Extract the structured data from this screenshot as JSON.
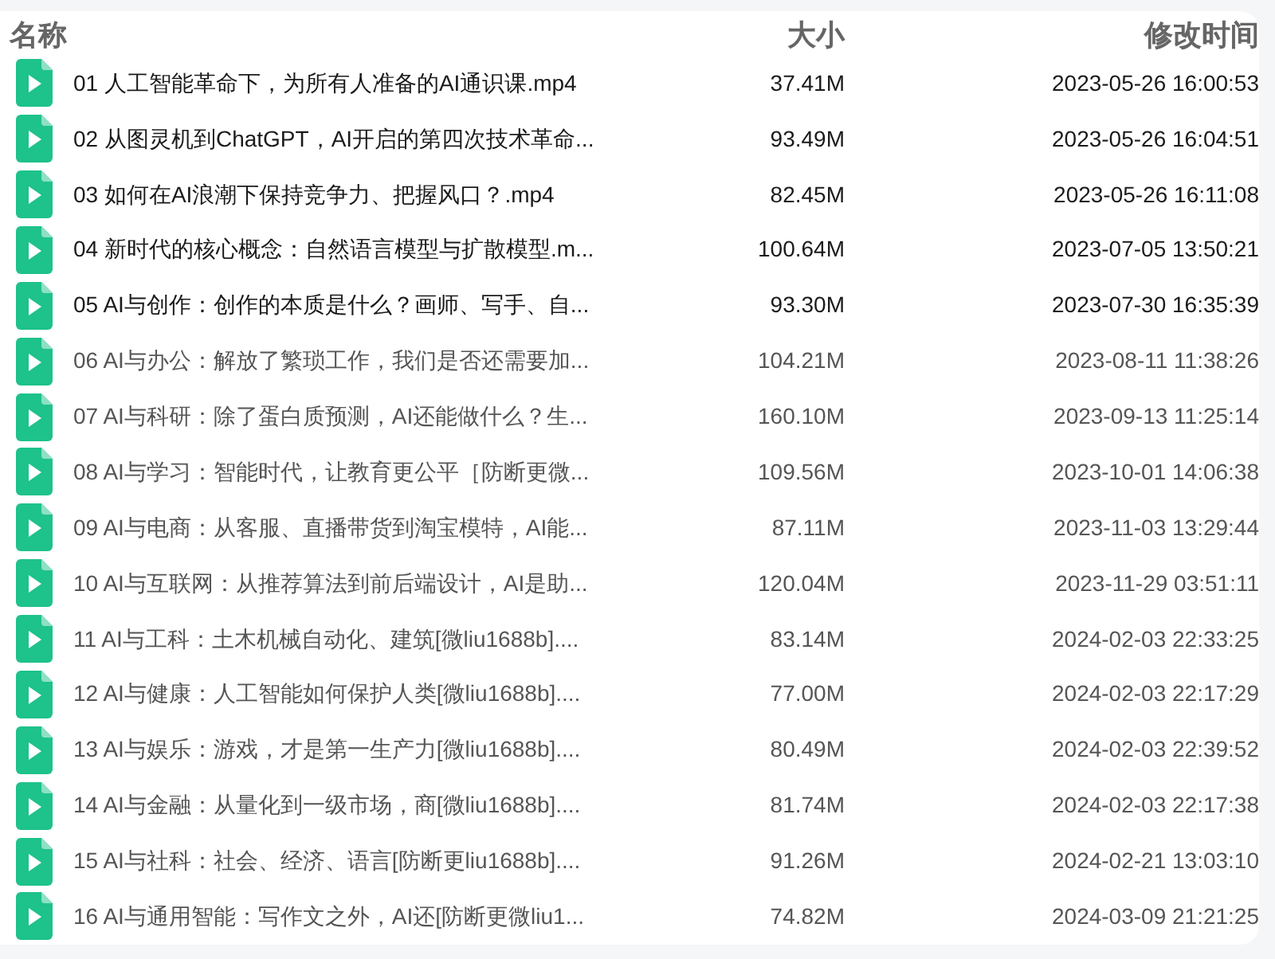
{
  "columns": [
    "名称",
    "大小",
    "修改时间"
  ],
  "files": [
    {
      "name": "01 人工智能革命下，为所有人准备的AI通识课.mp4",
      "size": "37.41M",
      "modified": "2023-05-26 16:00:53",
      "dimmed": false
    },
    {
      "name": "02 从图灵机到ChatGPT，AI开启的第四次技术革命...",
      "size": "93.49M",
      "modified": "2023-05-26 16:04:51",
      "dimmed": false
    },
    {
      "name": "03 如何在AI浪潮下保持竞争力、把握风口？.mp4",
      "size": "82.45M",
      "modified": "2023-05-26 16:11:08",
      "dimmed": false
    },
    {
      "name": "04 新时代的核心概念：自然语言模型与扩散模型.m...",
      "size": "100.64M",
      "modified": "2023-07-05 13:50:21",
      "dimmed": false
    },
    {
      "name": "05 AI与创作：创作的本质是什么？画师、写手、自...",
      "size": "93.30M",
      "modified": "2023-07-30 16:35:39",
      "dimmed": false
    },
    {
      "name": "06 AI与办公：解放了繁琐工作，我们是否还需要加...",
      "size": "104.21M",
      "modified": "2023-08-11 11:38:26",
      "dimmed": true
    },
    {
      "name": "07 AI与科研：除了蛋白质预测，AI还能做什么？生...",
      "size": "160.10M",
      "modified": "2023-09-13 11:25:14",
      "dimmed": true
    },
    {
      "name": "08 AI与学习：智能时代，让教育更公平［防断更微...",
      "size": "109.56M",
      "modified": "2023-10-01 14:06:38",
      "dimmed": true
    },
    {
      "name": "09 AI与电商：从客服、直播带货到淘宝模特，AI能...",
      "size": "87.11M",
      "modified": "2023-11-03 13:29:44",
      "dimmed": true
    },
    {
      "name": "10 AI与互联网：从推荐算法到前后端设计，AI是助...",
      "size": "120.04M",
      "modified": "2023-11-29 03:51:11",
      "dimmed": true
    },
    {
      "name": "11 AI与工科：土木机械自动化、建筑[微liu1688b]....",
      "size": "83.14M",
      "modified": "2024-02-03 22:33:25",
      "dimmed": true
    },
    {
      "name": "12 AI与健康：人工智能如何保护人类[微liu1688b]....",
      "size": "77.00M",
      "modified": "2024-02-03 22:17:29",
      "dimmed": true
    },
    {
      "name": "13 AI与娱乐：游戏，才是第一生产力[微liu1688b]....",
      "size": "80.49M",
      "modified": "2024-02-03 22:39:52",
      "dimmed": true
    },
    {
      "name": "14 AI与金融：从量化到一级市场，商[微liu1688b]....",
      "size": "81.74M",
      "modified": "2024-02-03 22:17:38",
      "dimmed": true
    },
    {
      "name": "15 AI与社科：社会、经济、语言[防断更liu1688b]....",
      "size": "91.26M",
      "modified": "2024-02-21 13:03:10",
      "dimmed": true
    },
    {
      "name": "16 AI与通用智能：写作文之外，AI还[防断更微liu1...",
      "size": "74.82M",
      "modified": "2024-03-09 21:21:25",
      "dimmed": true
    }
  ]
}
